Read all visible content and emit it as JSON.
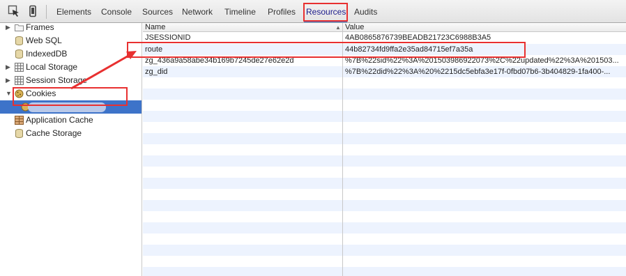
{
  "toolbar": {
    "tabs": [
      {
        "label": "Elements"
      },
      {
        "label": "Console"
      },
      {
        "label": "Sources"
      },
      {
        "label": "Network"
      },
      {
        "label": "Timeline"
      },
      {
        "label": "Profiles"
      },
      {
        "label": "Resources",
        "active": true
      },
      {
        "label": "Audits"
      }
    ]
  },
  "sidebar": {
    "items": [
      {
        "label": "Frames",
        "icon": "folder-icon",
        "expandable": true
      },
      {
        "label": "Web SQL",
        "icon": "database-icon"
      },
      {
        "label": "IndexedDB",
        "icon": "database-icon"
      },
      {
        "label": "Local Storage",
        "icon": "storage-grid-icon",
        "expandable": true
      },
      {
        "label": "Session Storage",
        "icon": "storage-grid-icon",
        "expandable": true
      },
      {
        "label": "Cookies",
        "icon": "cookie-icon",
        "expanded": true
      },
      {
        "label": "",
        "icon": "cookie-icon",
        "selected": true,
        "redacted": true
      },
      {
        "label": "Application Cache",
        "icon": "application-cache-icon"
      },
      {
        "label": "Cache Storage",
        "icon": "database-icon"
      }
    ]
  },
  "table": {
    "headers": {
      "name": "Name",
      "value": "Value"
    },
    "rows": [
      {
        "name": "JSESSIONID",
        "value": "4AB0865876739BEADB21723C6988B3A5"
      },
      {
        "name": "route",
        "value": "44b82734fd9ffa2e35ad84715ef7a35a"
      },
      {
        "name": "zg_436a9a58abe34b169b7245de27e62e2d",
        "value": "%7B%22sid%22%3A%201503986922073%2C%22updated%22%3A%201503..."
      },
      {
        "name": "zg_did",
        "value": "%7B%22did%22%3A%20%2215dc5ebfa3e17f-0fbd07b6-3b404829-1fa400-..."
      }
    ]
  },
  "colors": {
    "annotation": "#e83030",
    "selection": "#3d73c9",
    "stripe": "#edf3fe",
    "active_tab_underline": "#3a7bd5"
  }
}
